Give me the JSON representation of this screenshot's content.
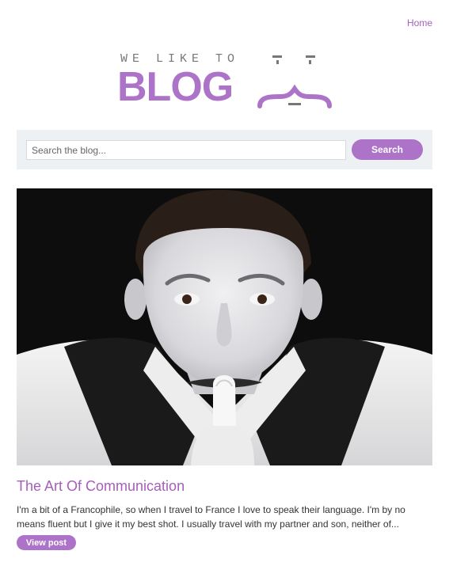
{
  "nav": {
    "home_label": "Home"
  },
  "logo": {
    "tagline": "WE LIKE TO",
    "wordmark": "BLOG",
    "icon": "face-icon"
  },
  "search": {
    "placeholder": "Search the blog...",
    "value": "",
    "button_label": "Search"
  },
  "post": {
    "image_alt": "Mime with white face paint holding a finger to his lips",
    "title": "The Art Of Communication",
    "excerpt": "I'm a bit of a Francophile, so when I travel to France I love to speak their language. I'm by no means fluent but I give it my best shot. I usually travel with my partner and son, neither of...",
    "view_label": "View post"
  },
  "colors": {
    "accent": "#ad73c8",
    "link": "#a55fb9",
    "search_bg": "#eef1f4"
  }
}
